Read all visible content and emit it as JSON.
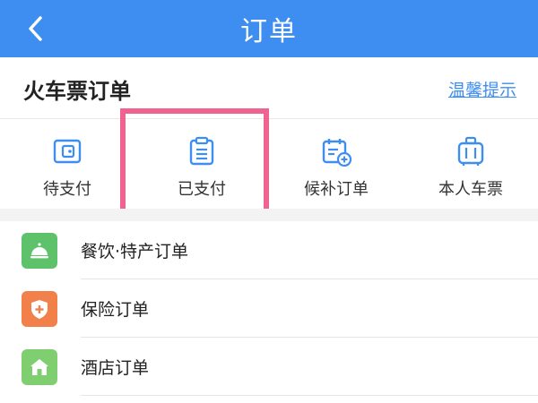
{
  "header": {
    "title": "订单",
    "back_icon": "chevron-left-icon",
    "background_color": "#3d8ef0"
  },
  "section": {
    "title": "火车票订单",
    "tips_link": "温馨提示",
    "link_color": "#3d8ef0"
  },
  "quick_actions": [
    {
      "label": "待支付",
      "icon": "wallet-icon"
    },
    {
      "label": "已支付",
      "icon": "clipboard-icon"
    },
    {
      "label": "候补订单",
      "icon": "calendar-add-icon"
    },
    {
      "label": "本人车票",
      "icon": "luggage-icon"
    }
  ],
  "highlight": {
    "target": "已支付",
    "color": "#f0628f"
  },
  "order_list": [
    {
      "label": "餐饮·特产订单",
      "icon": "service-bell-icon",
      "icon_color": "#5ec26a"
    },
    {
      "label": "保险订单",
      "icon": "shield-plus-icon",
      "icon_color": "#f2804a"
    },
    {
      "label": "酒店订单",
      "icon": "hotel-icon",
      "icon_color": "#7fcf70"
    }
  ]
}
